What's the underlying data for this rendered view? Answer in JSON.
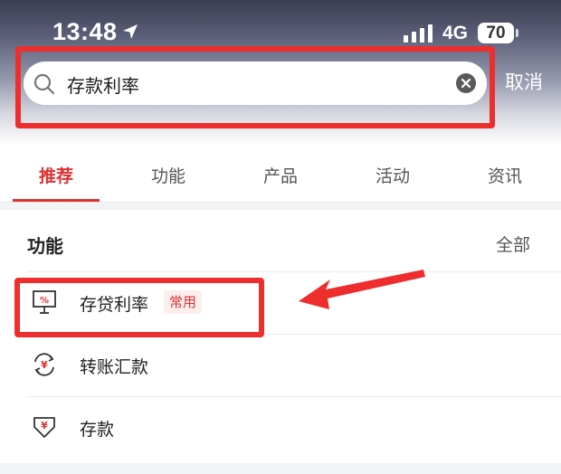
{
  "status_bar": {
    "time": "13:48",
    "network": "4G",
    "battery": "70"
  },
  "search": {
    "query": "存款利率",
    "cancel_label": "取消"
  },
  "tabs": [
    {
      "label": "推荐",
      "active": true
    },
    {
      "label": "功能",
      "active": false
    },
    {
      "label": "产品",
      "active": false
    },
    {
      "label": "活动",
      "active": false
    },
    {
      "label": "资讯",
      "active": false
    }
  ],
  "section": {
    "title": "功能",
    "see_all": "全部",
    "items": [
      {
        "label": "存贷利率",
        "badge": "常用",
        "icon": "rate-chart-icon"
      },
      {
        "label": "转账汇款",
        "icon": "transfer-icon"
      },
      {
        "label": "存款",
        "icon": "deposit-icon"
      }
    ]
  },
  "colors": {
    "accent": "#e03131",
    "highlight": "#ee2d2d"
  }
}
